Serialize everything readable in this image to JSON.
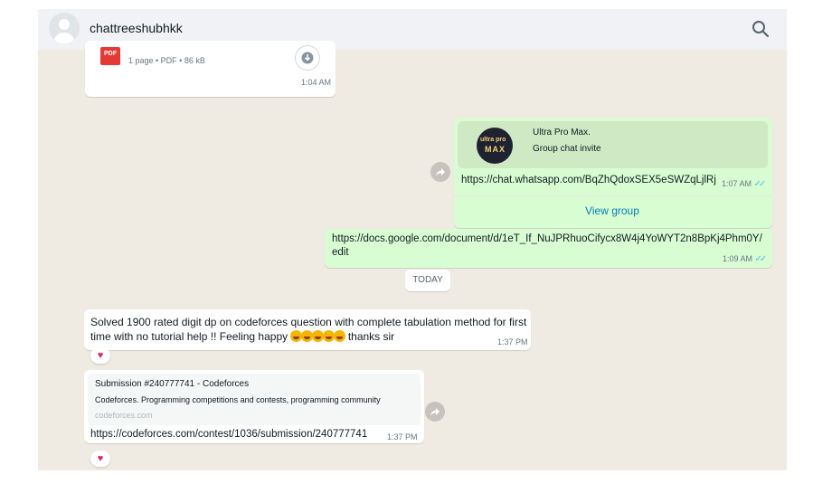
{
  "header": {
    "contact_name": "chattreeshubhkk",
    "search_icon": "search-icon"
  },
  "messages": {
    "pdf": {
      "icon_label": "PDF",
      "meta": "1 page • PDF • 86 kB",
      "time": "1:04 AM"
    },
    "invite": {
      "group_name": "Ultra Pro Max.",
      "subtitle": "Group chat invite",
      "logo_line1": "ultra pro",
      "logo_line2": "MAX",
      "link": "https://chat.whatsapp.com/BqZhQdoxSEX5eSWZqLjlRj",
      "time": "1:07 AM",
      "ticks": "✓✓",
      "action": "View group"
    },
    "docs": {
      "link_line1": "https://docs.google.com/document/d/1eT_If_NuJPRhuoCifycx8W4j4YoWYT2n8BpKj4Phm0Y/",
      "link_line2": "edit",
      "time": "1:09 AM",
      "ticks": "✓✓"
    },
    "divider": "TODAY",
    "solved": {
      "line1": "Solved 1900 rated digit dp on codeforces question with complete tabulation method for first",
      "line2_start": "time with no tutorial help !! Feeling happy",
      "line2_end": "thanks sir",
      "time": "1:37 PM",
      "reaction": "♥"
    },
    "codeforces": {
      "preview_title": "Submission #240777741 - Codeforces",
      "preview_desc": "Codeforces. Programming competitions and contests, programming community",
      "preview_domain": "codeforces.com",
      "link": "https://codeforces.com/contest/1036/submission/240777741",
      "time": "1:37 PM",
      "reaction": "♥"
    }
  },
  "colors": {
    "chat_bg": "#efeae2",
    "incoming": "#ffffff",
    "outgoing": "#d9fdd3",
    "link": "#027eb5",
    "read_ticks": "#53bdeb"
  }
}
